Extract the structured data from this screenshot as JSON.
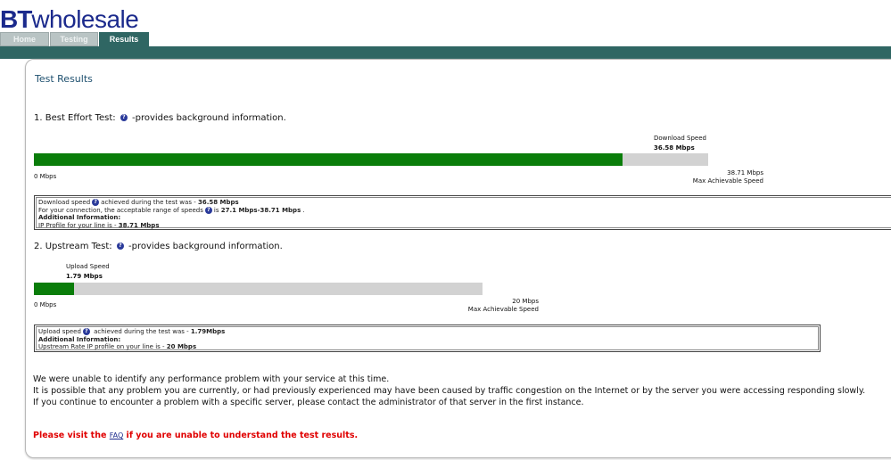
{
  "brand": {
    "bt": "BT",
    "wholesale": "wholesale",
    "color": "#1b2a8c"
  },
  "tabs": [
    {
      "label": "Home",
      "state": "inactive"
    },
    {
      "label": "Testing",
      "state": "inactive"
    },
    {
      "label": "Results",
      "state": "active"
    }
  ],
  "accent_color": "#2f6663",
  "page_title": "Test Results",
  "download": {
    "heading_prefix": "1. Best Effort Test:",
    "heading_suffix": "-provides background information.",
    "speed_label": "Download Speed",
    "speed_value": "36.58 Mbps",
    "measured_mbps": 36.58,
    "max_mbps": 38.71,
    "min_label": "0 Mbps",
    "max_label": "38.71 Mbps",
    "max_caption": "Max Achievable Speed",
    "bar_color": "#0a7d0a",
    "info": {
      "line1_text": "Download speed",
      "line1_mid": "achieved during the test was - ",
      "line1_value": "36.58 Mbps",
      "line2_text": "For your connection, the acceptable range of speeds",
      "line2_mid": "is ",
      "line2_value": "27.1 Mbps-38.71 Mbps",
      "line2_end": " .",
      "additional": "Additional Information:",
      "line3_text": "IP Profile for your line is - ",
      "line3_value": "38.71 Mbps"
    }
  },
  "upload": {
    "heading_prefix": "2. Upstream Test:",
    "heading_suffix": "-provides background information.",
    "speed_label": "Upload Speed",
    "speed_value": "1.79 Mbps",
    "measured_mbps": 1.79,
    "max_mbps": 20,
    "min_label": "0 Mbps",
    "max_label": "20 Mbps",
    "max_caption": "Max Achievable Speed",
    "info": {
      "line1_text": "Upload speed",
      "line1_mid": " achieved during the test was - ",
      "line1_value": "1.79Mbps",
      "additional": "Additional Information:",
      "line2_text": "Upstream Rate IP profile on your line is - ",
      "line2_value": "20 Mbps"
    }
  },
  "message": {
    "line1": "We were unable to identify any performance problem with your service at this time.",
    "line2": "It is possible that any problem you are currently, or had previously experienced may have been caused by traffic congestion on the Internet or by the server you were accessing responding slowly.",
    "line3": "If you continue to encounter a problem with a specific server, please contact the administrator of that server in the first instance."
  },
  "faq": {
    "before": "Please visit the ",
    "link": "FAQ",
    "after": " if you are unable to understand the test results."
  },
  "help_icon": "question-circle-icon"
}
